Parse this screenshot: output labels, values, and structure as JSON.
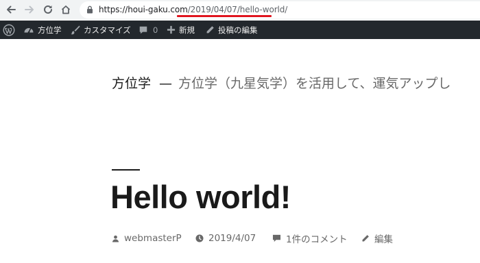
{
  "browser": {
    "url_host": "https://houi-gaku.com",
    "url_path": "/2019/04/07/hello-world/"
  },
  "admin_bar": {
    "site_name": "方位学",
    "customize": "カスタマイズ",
    "comments_count": "0",
    "new_label": "新規",
    "edit_post": "投稿の編集"
  },
  "site": {
    "title": "方位学",
    "separator": "—",
    "description": "方位学（九星気学）を活用して、運気アップし"
  },
  "post": {
    "title": "Hello world!",
    "author": "webmasterP",
    "date": "2019/4/07",
    "comments": "1件のコメント",
    "edit": "編集"
  },
  "colors": {
    "admin_bar_bg": "#23282d",
    "highlight_underline": "#e0141e",
    "browser_bar_bg": "#f1f3f4"
  }
}
